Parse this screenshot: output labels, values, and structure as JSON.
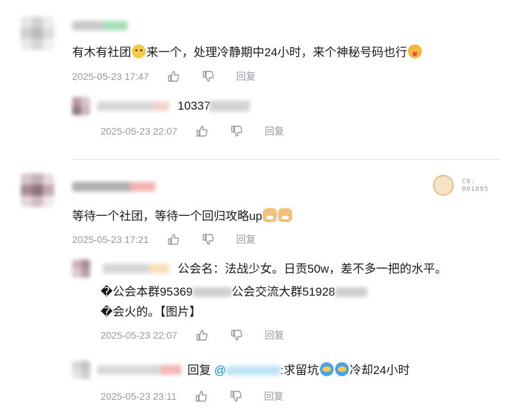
{
  "comments": [
    {
      "text_before_emoji": "有木有社团",
      "text_after_emoji": "来一个，处理冷静期中24小时，来个神秘号码也行",
      "time": "2025-05-23 17:47",
      "reply_label": "回复",
      "replies": [
        {
          "text": "10337",
          "time": "2025-05-23 22:07",
          "reply_label": "回复"
        }
      ]
    },
    {
      "text": "等待一个社团，等待一个回归攻略up",
      "time": "2025-05-23 17:21",
      "reply_label": "回复",
      "badge": {
        "line1": "CO.",
        "line2": "001895"
      },
      "replies": [
        {
          "line1": "公会名：法战少女。日贡50w，差不多一把的水平。",
          "line2_a": "�公会本群95369",
          "line2_b": "公会交流大群51928",
          "line3": "�会火的。【图片】",
          "time": "2025-05-23 22:07",
          "reply_label": "回复"
        },
        {
          "prefix": "回复",
          "at": "@",
          "suffix_a": ":求留坑",
          "suffix_b": "冷却24小时",
          "time": "2025-05-23 23:11",
          "reply_label": "回复"
        }
      ]
    }
  ],
  "icons": {
    "like": "thumbs-up-icon",
    "dislike": "thumbs-down-icon"
  },
  "colors": {
    "text": "#18191c",
    "meta": "#9499a0",
    "divider": "#e3e5e7",
    "mention": "#008ac5"
  }
}
